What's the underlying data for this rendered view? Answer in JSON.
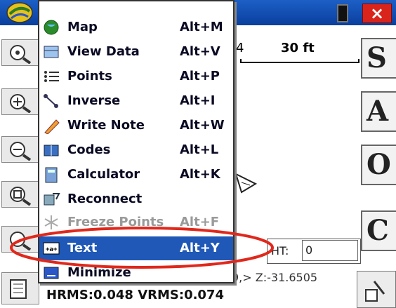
{
  "window": {
    "close_label": "×"
  },
  "map": {
    "scale_prev": "4",
    "scale": "30 ft",
    "ht_label": "HT:",
    "ht_value": "0",
    "coords": "9,> Z:-31.6505",
    "status": "HRMS:0.048 VRMS:0.074"
  },
  "right_toolbar": [
    "S",
    "A",
    "O",
    "C"
  ],
  "menu": {
    "items": [
      {
        "label": "Map",
        "shortcut": "Alt+M",
        "icon": "globe-icon"
      },
      {
        "label": "View Data",
        "shortcut": "Alt+V",
        "icon": "view-data-icon"
      },
      {
        "label": "Points",
        "shortcut": "Alt+P",
        "icon": "points-list-icon"
      },
      {
        "label": "Inverse",
        "shortcut": "Alt+I",
        "icon": "inverse-icon"
      },
      {
        "label": "Write Note",
        "shortcut": "Alt+W",
        "icon": "pencil-icon"
      },
      {
        "label": "Codes",
        "shortcut": "Alt+L",
        "icon": "codes-book-icon"
      },
      {
        "label": "Calculator",
        "shortcut": "Alt+K",
        "icon": "calculator-icon"
      },
      {
        "label": "Reconnect",
        "shortcut": "",
        "icon": "reconnect-icon"
      },
      {
        "label": "Freeze Points",
        "shortcut": "Alt+F",
        "icon": "freeze-icon"
      },
      {
        "label": "Text",
        "shortcut": "Alt+Y",
        "icon": "text-icon"
      },
      {
        "label": "Minimize",
        "shortcut": "",
        "icon": "minimize-icon"
      }
    ],
    "selected_index": 9
  },
  "colors": {
    "titlebar": "#0a3f9e",
    "selection": "#1f58b6",
    "highlight_ring": "#e0281c",
    "close": "#d9241c"
  }
}
